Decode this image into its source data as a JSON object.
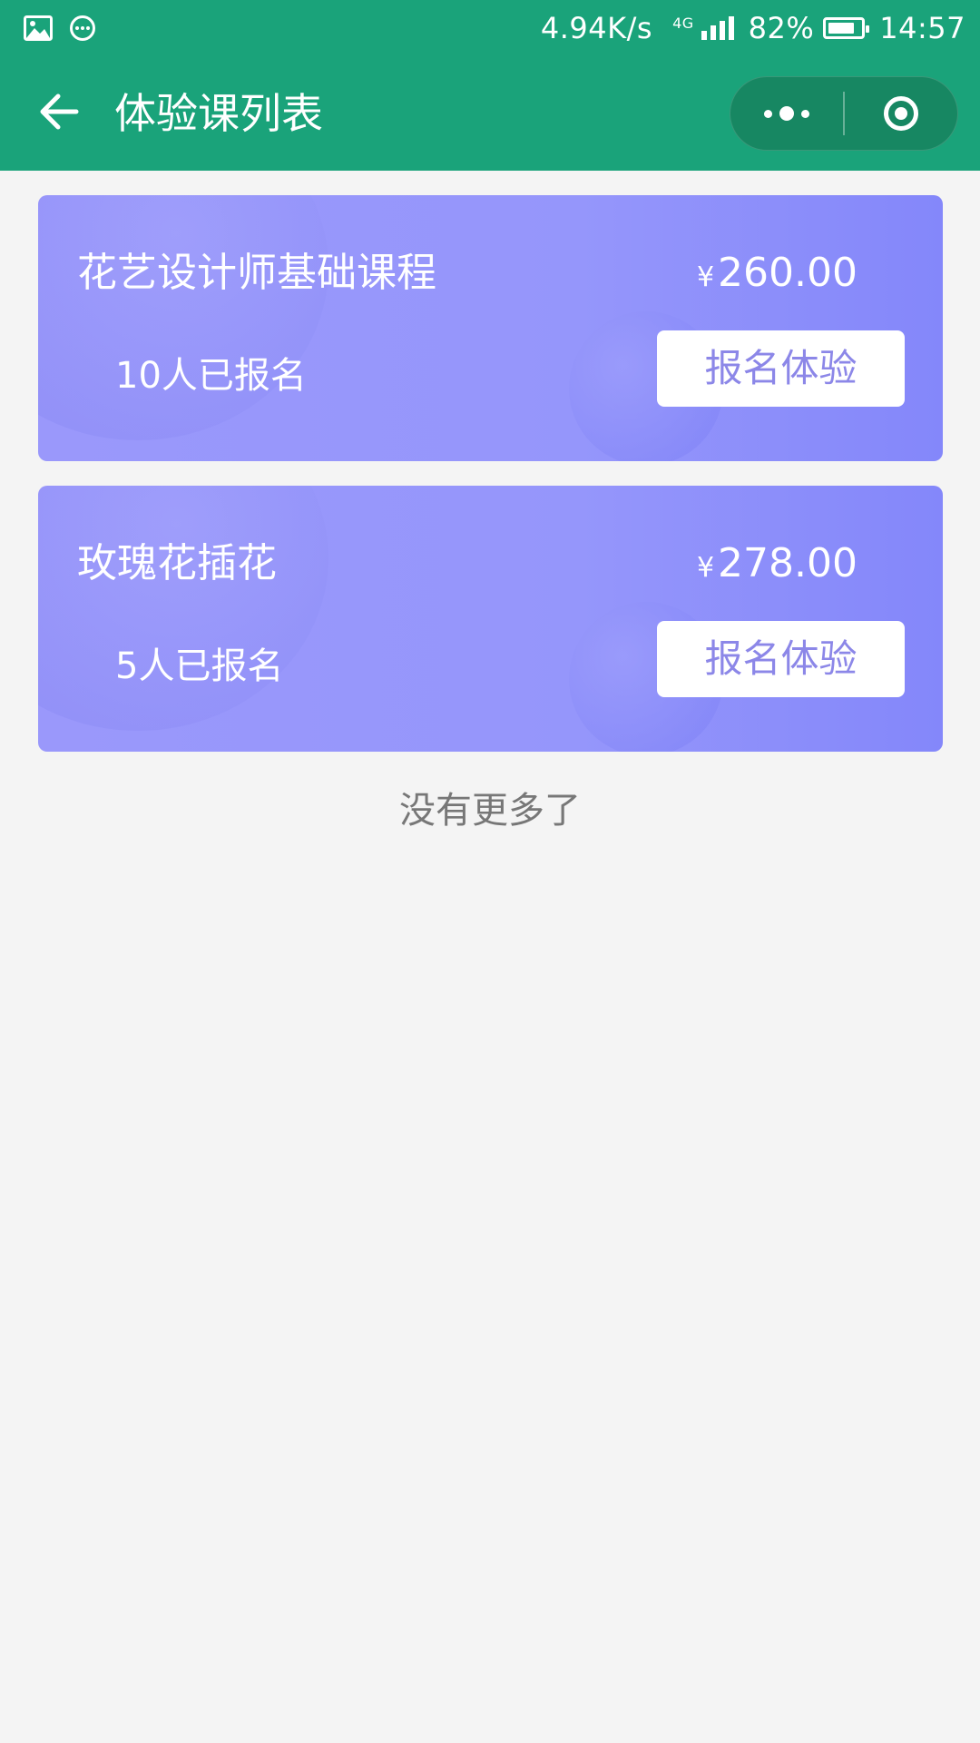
{
  "status_bar": {
    "net_speed": "4.94K/s",
    "network_type": "4G",
    "battery_percent": "82%",
    "battery_level": 0.82,
    "time": "14:57",
    "icons": [
      "image-icon",
      "chat-bubble-icon",
      "signal-icon",
      "battery-icon"
    ]
  },
  "nav": {
    "title": "体验课列表",
    "back_icon": "back-arrow-icon",
    "more_icon": "more-dots-icon",
    "close_icon": "target-circle-icon"
  },
  "courses": [
    {
      "title": "花艺设计师基础课程",
      "currency": "¥",
      "price": "260.00",
      "enrolled": "10人已报名",
      "button_label": "报名体验"
    },
    {
      "title": "玫瑰花插花",
      "currency": "¥",
      "price": "278.00",
      "enrolled": "5人已报名",
      "button_label": "报名体验"
    }
  ],
  "footer": {
    "no_more": "没有更多了"
  },
  "colors": {
    "header": "#1aa37a",
    "capsule": "#178762",
    "card_gradient_start": "#9a98fb",
    "card_gradient_end": "#8487fa",
    "button_text": "#8c87e8",
    "background": "#f4f4f4"
  }
}
